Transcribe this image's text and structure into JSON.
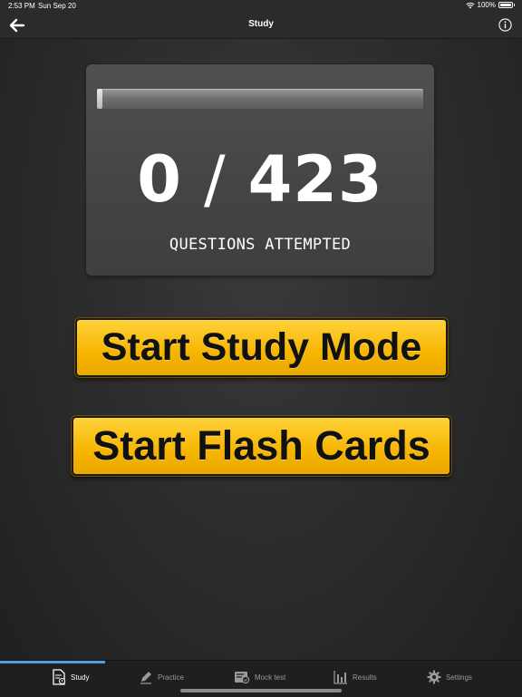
{
  "status_bar": {
    "time": "2:53 PM",
    "date": "Sun Sep 20",
    "battery": "100%"
  },
  "nav": {
    "title": "Study"
  },
  "stats": {
    "attempted": "0",
    "separator": "/",
    "total": "423",
    "caption": "QUESTIONS ATTEMPTED",
    "progress_fraction": 0
  },
  "buttons": {
    "study_mode": "Start Study Mode",
    "flash_cards": "Start Flash Cards"
  },
  "tabs": [
    {
      "label": "Study",
      "icon": "study-doc-icon",
      "active": true
    },
    {
      "label": "Practice",
      "icon": "pencil-icon",
      "active": false
    },
    {
      "label": "Mock test",
      "icon": "mock-test-icon",
      "active": false
    },
    {
      "label": "Results",
      "icon": "bar-chart-icon",
      "active": false
    },
    {
      "label": "Settings",
      "icon": "gear-icon",
      "active": false
    }
  ],
  "colors": {
    "button_yellow": "#f6b500",
    "active_tab_indicator": "#4aa3df",
    "background": "#2a2a2a"
  }
}
